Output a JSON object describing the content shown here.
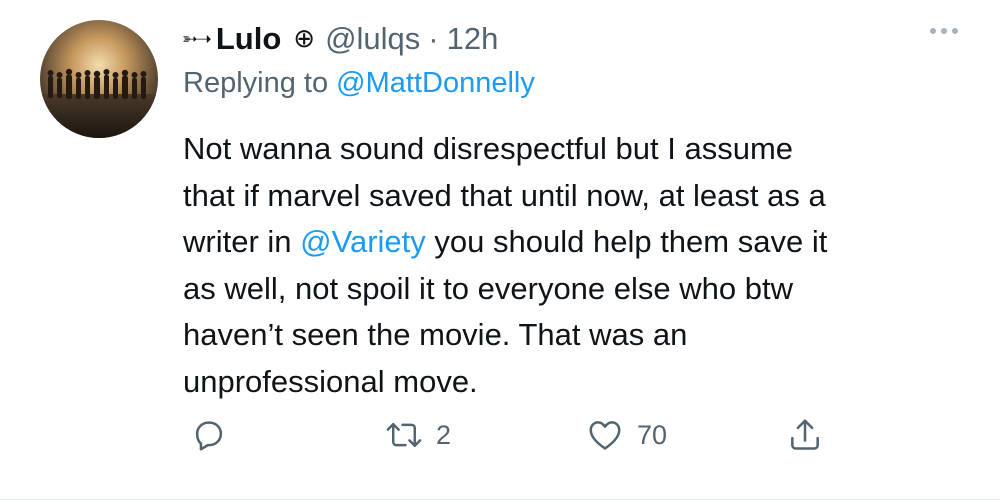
{
  "tweet": {
    "author": {
      "prefix_emoji": "➳➝",
      "display_name": "Lulo",
      "name_emoji": "⊕",
      "handle": "@lulqs",
      "separator": "·",
      "time": "12h"
    },
    "reply": {
      "prefix": "Replying to ",
      "mention": "@MattDonnelly"
    },
    "text": {
      "line1": "Not wanna sound disrespectful but I assume",
      "line2": "that if marvel saved that until now, at least as a",
      "line3_before": "writer in ",
      "line3_mention": "@Variety",
      "line3_after": " you should help them save it",
      "line4": "as well, not spoil it to everyone else who btw",
      "line5": "haven’t seen the movie. That was an",
      "line6": "unprofessional move."
    },
    "actions": {
      "reply_icon": "speech-bubble-icon",
      "retweet_icon": "retweet-icon",
      "retweet_count": "2",
      "like_icon": "heart-icon",
      "like_count": "70",
      "share_icon": "share-icon"
    },
    "colors": {
      "text": "#0f1419",
      "secondary": "#536471",
      "link": "#1d9bf0"
    }
  }
}
